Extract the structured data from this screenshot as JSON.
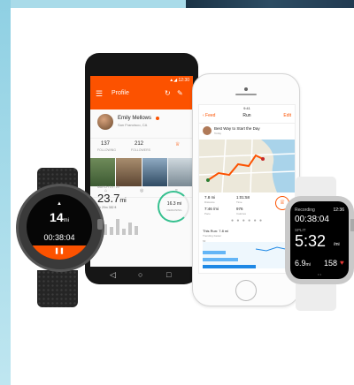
{
  "android": {
    "status": "▲◢ 12:30",
    "title": "Profile",
    "profile": {
      "name": "Emily Mellows",
      "location": "San Francisco, CA",
      "following_count": "137",
      "following_label": "FOLLOWING",
      "followers_count": "212",
      "followers_label": "FOLLOWERS"
    },
    "stats": {
      "date_label": "MARCH 14 - 20",
      "distance": "23.7",
      "distance_unit": "mi",
      "sub": "3h 29m  382 ft",
      "ring_value": "16.3 mi",
      "ring_label": "REMAINING"
    },
    "nav": {
      "back": "◁",
      "home": "○",
      "recents": "□"
    }
  },
  "iphone": {
    "status": "9:41",
    "back_label": "‹ Feed",
    "title": "Run",
    "edit_label": "Edit",
    "activity_title": "Best Way to Start the Day",
    "activity_sub": "Today",
    "stats": [
      {
        "value": "7.8 mi",
        "label": "Distance"
      },
      {
        "value": "1:01:58",
        "label": "Time"
      },
      {
        "value": "7:46 /mi",
        "label": "Pace"
      },
      {
        "value": "976",
        "label": "Calories"
      }
    ],
    "trophy_icon": "trophy-icon",
    "dots": "● ● ● ● ● ●",
    "run_title": "This Run: 7.8 mi",
    "run_sub": "Trending Faster",
    "split_label": "MI"
  },
  "black_watch": {
    "arrow": "▲",
    "distance": "14",
    "distance_unit": "mi",
    "time": "00:38:04",
    "pause_icon": "pause-icon"
  },
  "apple_watch": {
    "recording_label": "Recording",
    "clock": "12:36",
    "elapsed": "00:38:04",
    "split_label": "SPLIT",
    "split": "5:32",
    "split_unit": "/mi",
    "distance": "6.9",
    "distance_unit": "mi",
    "heart_rate": "158",
    "heart_icon": "heart-icon",
    "page_dots": "• •"
  }
}
